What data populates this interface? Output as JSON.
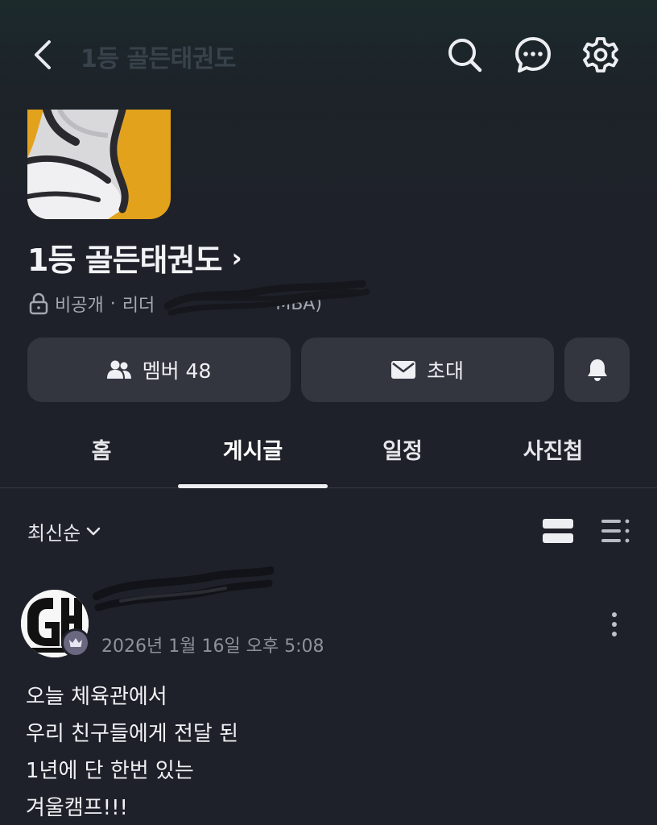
{
  "header": {
    "title": "1등 골든태권도",
    "icons": [
      "back-icon",
      "search-icon",
      "chat-icon",
      "settings-icon"
    ]
  },
  "band": {
    "name": "1등 골든태권도",
    "arrow": "›",
    "privacy": "비공개",
    "separator": "·",
    "leader_label": "리더",
    "leader_name_suffix": "MBA)"
  },
  "actions": {
    "members_label": "멤버 48",
    "invite_label": "초대"
  },
  "tabs": [
    {
      "label": "홈",
      "active": false
    },
    {
      "label": "게시글",
      "active": true
    },
    {
      "label": "일정",
      "active": false
    },
    {
      "label": "사진첩",
      "active": false
    }
  ],
  "sort": {
    "label": "최신순"
  },
  "post": {
    "timestamp": "2026년 1월 16일 오후 5:08",
    "lines": [
      "오늘 체육관에서",
      "우리 친구들에게 전달 된",
      "1년에 단 한번 있는",
      "겨울캠프!!!"
    ]
  },
  "colors": {
    "background": "#1e2129",
    "button": "#33363f",
    "accent_yellow": "#e2a21c",
    "badge": "#6a6780"
  }
}
